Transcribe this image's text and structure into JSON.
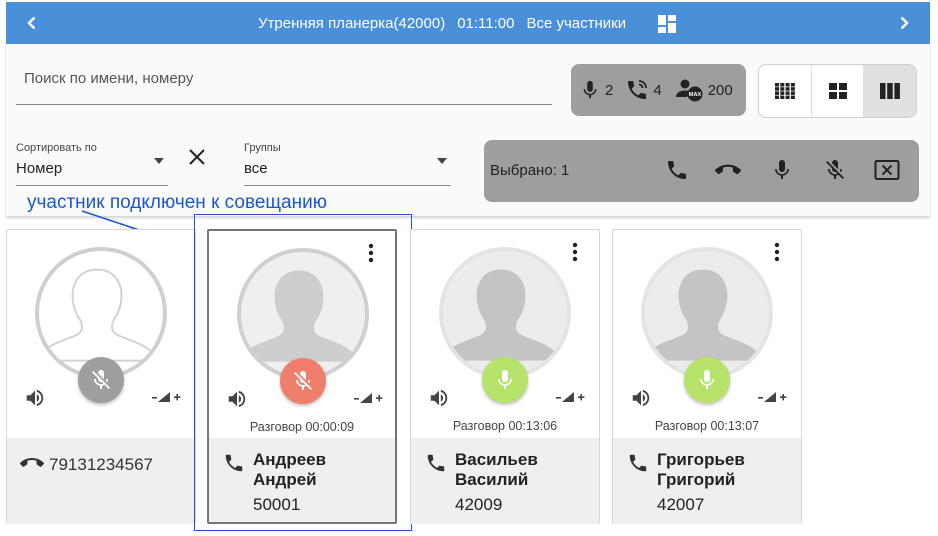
{
  "header": {
    "title": "Утренняя планерка(42000)",
    "timer": "01:11:00",
    "filter": "Все участники"
  },
  "search": {
    "placeholder": "Поиск по имени, номеру"
  },
  "stats": {
    "speaking": "2",
    "calls": "4",
    "max": "200",
    "max_badge": "MAX"
  },
  "sort": {
    "label": "Сортировать по",
    "value": "Номер"
  },
  "groups": {
    "label": "Группы",
    "value": "все"
  },
  "selection": {
    "text": "Выбрано: 1"
  },
  "annotation": {
    "text": "участник подключен к совещанию"
  },
  "colors": {
    "header": "#4a90d9",
    "mic_off_gray": "#9e9e9e",
    "mic_off_red": "#ef7f6c",
    "mic_on_green": "#b6e36a",
    "annotation": "#1a56d6"
  },
  "participants": [
    {
      "status": "dialing",
      "mic": "muted-gray",
      "talk": "",
      "name": "",
      "number": "79131234567"
    },
    {
      "status": "connected",
      "mic": "muted-red",
      "talk": "Разговор 00:00:09",
      "name": "Андреев Андрей",
      "number": "50001"
    },
    {
      "status": "connected",
      "mic": "on",
      "talk": "Разговор 00:13:06",
      "name": "Васильев Василий",
      "number": "42009"
    },
    {
      "status": "connected",
      "mic": "on",
      "talk": "Разговор 00:13:07",
      "name": "Григорьев Григорий",
      "number": "42007"
    }
  ]
}
